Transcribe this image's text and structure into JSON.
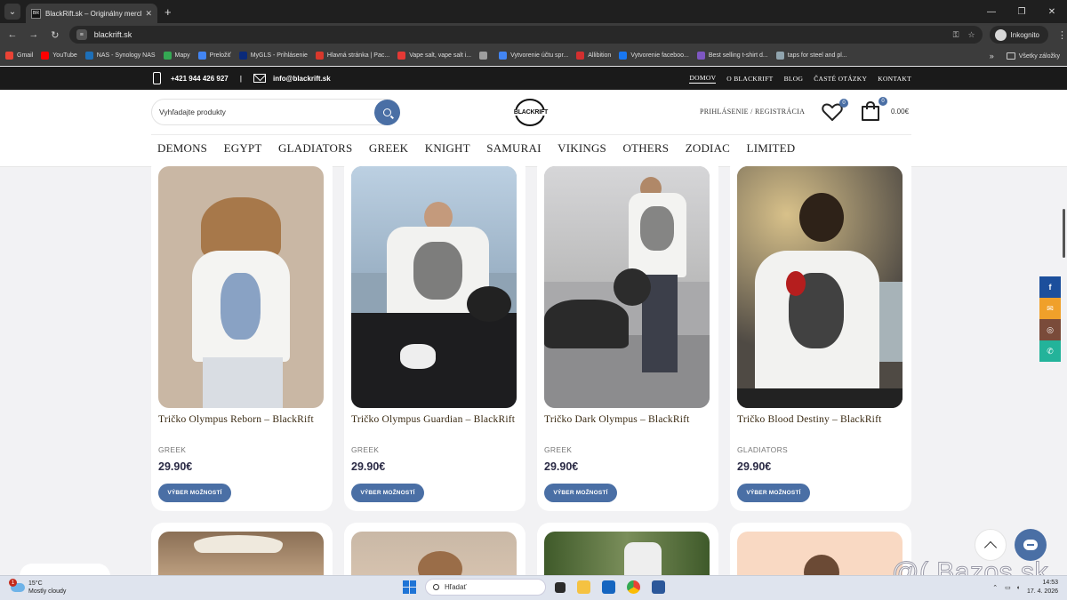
{
  "browser": {
    "tab_title": "BlackRift.sk – Originálny merch",
    "url": "blackrift.sk",
    "incognito_label": "Inkognito",
    "bookmarks": [
      {
        "label": "Gmail",
        "color": "#ea4335"
      },
      {
        "label": "YouTube",
        "color": "#ff0000"
      },
      {
        "label": "NAS - Synology NAS",
        "color": "#1d6fb8"
      },
      {
        "label": "Mapy",
        "color": "#34a853"
      },
      {
        "label": "Preložiť",
        "color": "#4285f4"
      },
      {
        "label": "MyGLS - Prihlásenie",
        "color": "#0a2a7a"
      },
      {
        "label": "Hlavná stránka | Pac...",
        "color": "#d9382c"
      },
      {
        "label": "Vape salt, vape salt i...",
        "color": "#e53935"
      },
      {
        "label": "",
        "color": "#9e9e9e"
      },
      {
        "label": "Vytvorenie účtu spr...",
        "color": "#4285f4"
      },
      {
        "label": "Allibition",
        "color": "#d32f2f"
      },
      {
        "label": "Vytvorenie faceboo...",
        "color": "#1877f2"
      },
      {
        "label": "Best selling t-shirt d...",
        "color": "#7e57c2"
      },
      {
        "label": "taps for steel and pl...",
        "color": "#90a4ae"
      }
    ],
    "bookmarks_all": "Všetky záložky"
  },
  "site": {
    "phone": "+421 944 426 927",
    "email": "info@blackrift.sk",
    "top_nav": [
      "DOMOV",
      "O BLACKRIFT",
      "BLOG",
      "ČASTÉ OTÁZKY",
      "KONTAKT"
    ],
    "search_placeholder": "Vyhľadajte produkty",
    "logo_text": "BLACKRIFT",
    "login_label": "PRIHLÁSENIE / REGISTRÁCIA",
    "wishlist_count": "0",
    "cart_count": "0",
    "cart_total": "0.00€",
    "categories": [
      "DEMONS",
      "EGYPT",
      "GLADIATORS",
      "GREEK",
      "KNIGHT",
      "SAMURAI",
      "VIKINGS",
      "OTHERS",
      "ZODIAC",
      "LIMITED"
    ]
  },
  "products": [
    {
      "name": "Tričko Olympus Reborn – BlackRift",
      "category": "GREEK",
      "price": "29.90€",
      "button": "VÝBER MOŽNOSTÍ",
      "bg": "#c9b7a4"
    },
    {
      "name": "Tričko Olympus Guardian – BlackRift",
      "category": "GREEK",
      "price": "29.90€",
      "button": "VÝBER MOŽNOSTÍ",
      "bg": "#8fa3b4"
    },
    {
      "name": "Tričko Dark Olympus – BlackRift",
      "category": "GREEK",
      "price": "29.90€",
      "button": "VÝBER MOŽNOSTÍ",
      "bg": "#a9a9ab"
    },
    {
      "name": "Tričko Blood Destiny – BlackRift",
      "category": "GLADIATORS",
      "price": "29.90€",
      "button": "VÝBER MOŽNOSTÍ",
      "bg": "#6b6258"
    }
  ],
  "social": [
    {
      "icon": "facebook-icon",
      "glyph": "f",
      "color": "#1c4f9c"
    },
    {
      "icon": "email-icon",
      "glyph": "✉",
      "color": "#f0a02a"
    },
    {
      "icon": "instagram-icon",
      "glyph": "◎",
      "color": "#7a4b3a"
    },
    {
      "icon": "whatsapp-icon",
      "glyph": "✆",
      "color": "#23b39a"
    }
  ],
  "watermark": "@( Bazos.sk",
  "taskbar": {
    "temp": "15°C",
    "weather": "Mostly cloudy",
    "search": "Hľadať",
    "time": "14:53",
    "date": "17. 4. 2026",
    "weather_badge": "1"
  }
}
